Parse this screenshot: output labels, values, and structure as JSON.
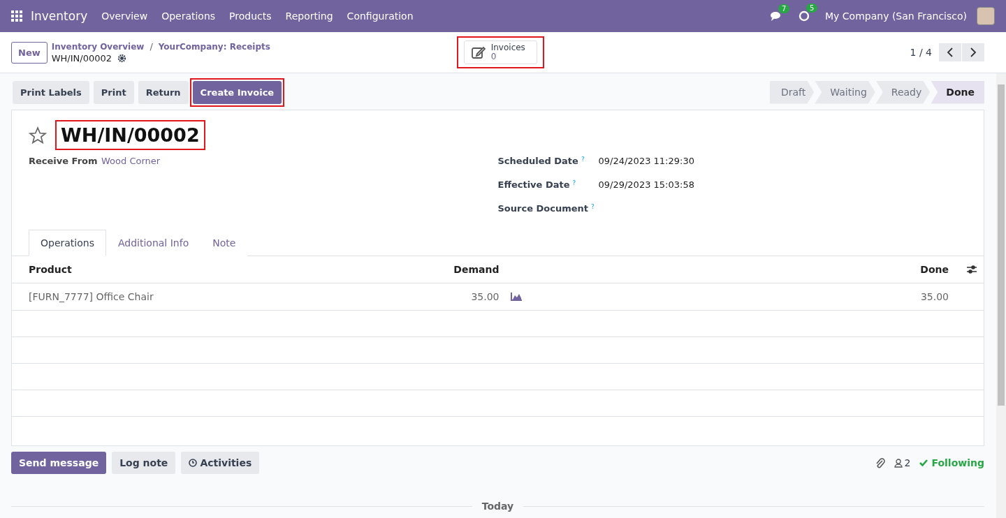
{
  "navbar": {
    "app_name": "Inventory",
    "menus": [
      "Overview",
      "Operations",
      "Products",
      "Reporting",
      "Configuration"
    ],
    "messages_count": "7",
    "activities_count": "5",
    "company": "My Company (San Francisco)"
  },
  "control_panel": {
    "new_button": "New",
    "breadcrumbs": [
      "Inventory Overview",
      "YourCompany: Receipts"
    ],
    "breadcrumb_separator": "/",
    "record_name": "WH/IN/00002",
    "smart_button": {
      "label": "Invoices",
      "count": "0",
      "highlighted": true
    },
    "pager": "1 / 4"
  },
  "actions": [
    {
      "label": "Print Labels",
      "primary": false,
      "highlighted": false
    },
    {
      "label": "Print",
      "primary": false,
      "highlighted": false
    },
    {
      "label": "Return",
      "primary": false,
      "highlighted": false
    },
    {
      "label": "Create Invoice",
      "primary": true,
      "highlighted": true
    }
  ],
  "statusbar": [
    {
      "label": "Draft",
      "selected": false
    },
    {
      "label": "Waiting",
      "selected": false
    },
    {
      "label": "Ready",
      "selected": false
    },
    {
      "label": "Done",
      "selected": true
    }
  ],
  "sheet": {
    "title": "WH/IN/00002",
    "title_highlighted": true,
    "starred": false,
    "left_fields": [
      {
        "label": "Receive From",
        "value": "Wood Corner"
      }
    ],
    "right_fields": [
      {
        "label": "Scheduled Date",
        "help": "?",
        "value": "09/24/2023 11:29:30"
      },
      {
        "label": "Effective Date",
        "help": "?",
        "value": "09/29/2023 15:03:58"
      },
      {
        "label": "Source Document",
        "help": "?"
      }
    ],
    "tabs": [
      {
        "label": "Operations",
        "selected": true
      },
      {
        "label": "Additional Info",
        "selected": false
      },
      {
        "label": "Note",
        "selected": false
      }
    ],
    "table": {
      "columns": [
        "Product",
        "Demand",
        "Done"
      ],
      "rows": [
        {
          "product": "[FURN_7777] Office Chair",
          "demand": "35.00",
          "done": "35.00"
        }
      ]
    }
  },
  "chatter": {
    "buttons": [
      {
        "label": "Send message",
        "primary": true
      },
      {
        "label": "Log note",
        "primary": false
      },
      {
        "label": "Activities",
        "primary": false
      }
    ],
    "followers": "2",
    "following": "Following",
    "divider": "Today"
  }
}
